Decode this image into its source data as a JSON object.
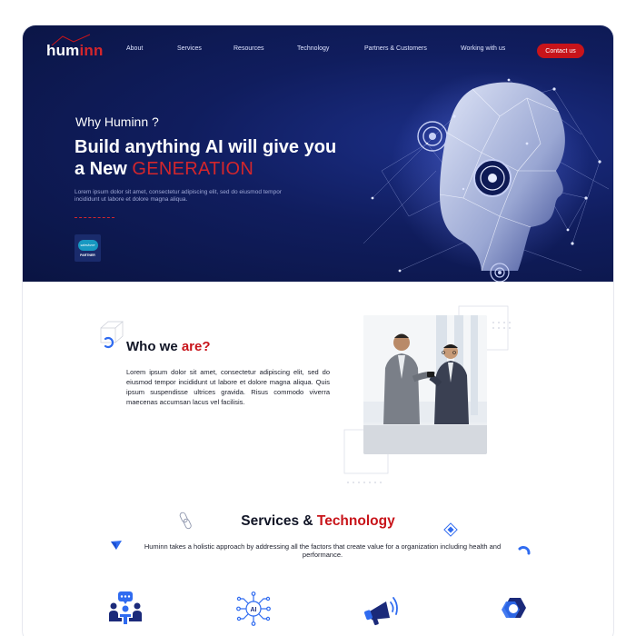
{
  "brand": {
    "logo_main": "hum",
    "logo_accent": "inn"
  },
  "nav": {
    "items": [
      {
        "label": "About"
      },
      {
        "label": "Services"
      },
      {
        "label": "Resources"
      },
      {
        "label": "Technology"
      },
      {
        "label": "Partners & Customers"
      },
      {
        "label": "Working with us"
      }
    ],
    "cta": "Contact us"
  },
  "hero": {
    "kicker": "Why Huminn ?",
    "title_main": "Build anything AI will give you a New ",
    "title_accent": "GENERATION",
    "description": "Lorem ipsum dolor sit amet, consectetur adipiscing elit, sed do eiusmod tempor incididunt ut labore et dolore magna aliqua.",
    "badge_logo": "salesforce",
    "badge_label": "PARTNER"
  },
  "about": {
    "title_main": "Who we ",
    "title_accent": "are?",
    "body": "Lorem ipsum dolor sit amet, consectetur adipiscing elit, sed do eiusmod tempor incididunt ut labore et dolore magna aliqua. Quis ipsum suspendisse ultrices gravida. Risus commodo viverra maecenas accumsan lacus vel facilisis."
  },
  "services": {
    "title_main": "Services & ",
    "title_accent": "Technology",
    "description": "Huminn takes a holistic approach by addressing all the factors that create value for a organization including health and performance.",
    "icons": [
      "team-meeting-icon",
      "ai-chip-icon",
      "megaphone-icon",
      "hexagon-gear-icon"
    ]
  },
  "colors": {
    "hero_bg": "#101d5e",
    "accent_red": "#c8141a",
    "accent_blue": "#2f6bf0",
    "text_dark": "#111526"
  }
}
